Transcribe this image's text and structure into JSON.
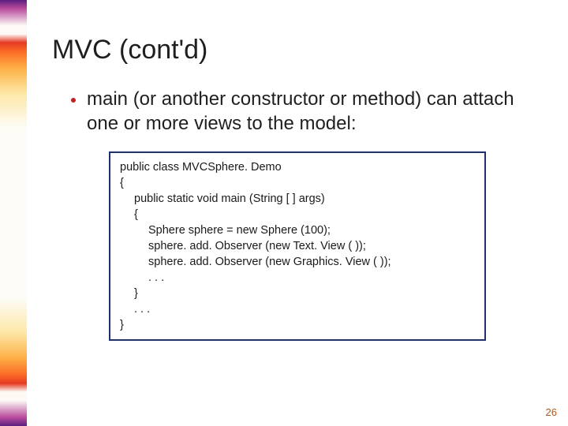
{
  "title": "MVC (cont'd)",
  "bullet": "main (or another constructor or method) can attach one or more views to the model:",
  "code": {
    "l01": "public class MVCSphere. Demo",
    "l02": "{",
    "l03": "public static void main (String [ ] args)",
    "l04": "{",
    "l05": "Sphere sphere = new Sphere (100);",
    "l06": "sphere. add. Observer (new Text. View ( ));",
    "l07": "sphere. add. Observer (new Graphics. View ( ));",
    "l08": ". . .",
    "l09": "}",
    "l10": ". . .",
    "l11": "}"
  },
  "page_number": "26"
}
